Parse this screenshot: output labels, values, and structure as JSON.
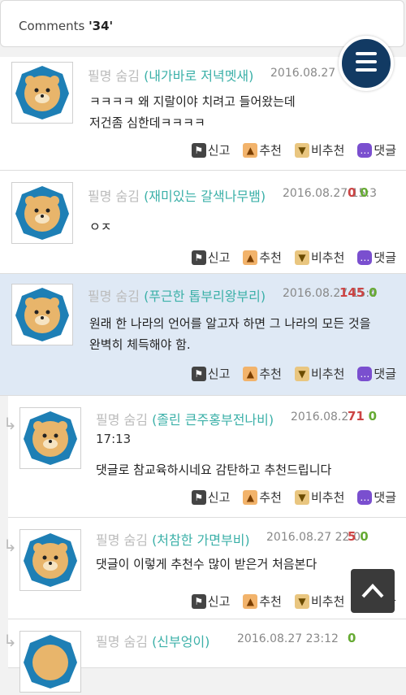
{
  "header": {
    "label": "Comments ",
    "count": "'34'"
  },
  "actions": {
    "report": "신고",
    "recommend": "추천",
    "unrecommend": "비추천",
    "reply": "댓글"
  },
  "comments": [
    {
      "author": "필명 숨김",
      "nickname": "(내가바로 저녁멧새)",
      "date": "2016.08.27",
      "up": "",
      "down": "",
      "lines": [
        "ㅋㅋㅋㅋ 왜 지랄이야 치려고 들어왔는데",
        "저건좀 심한데ㅋㅋㅋㅋ"
      ]
    },
    {
      "author": "필명 숨김",
      "nickname": "(재미있는 갈색나무뱀)",
      "date": "2016.08.27 15:3",
      "up": "0",
      "down": "0",
      "lines": [
        "ㅇㅈ"
      ]
    },
    {
      "author": "필명 숨김",
      "nickname": "(푸근한 톱부리왕부리)",
      "date": "2016.08.27 15:4",
      "up": "145",
      "down": "0",
      "lines": [
        "원래 한 나라의 언어를 알고자 하면 그 나라의 모든 것을",
        "완벽히 체득해야 함."
      ]
    },
    {
      "author": "필명 숨김",
      "nickname": "(졸린 큰주홍부전나비)",
      "date": "2016.08.2",
      "up": "71",
      "down": "0",
      "time": "17:13",
      "lines": [
        "댓글로 참교육하시네요 감탄하고 추천드립니다"
      ]
    },
    {
      "author": "필명 숨김",
      "nickname": "(처참한 가면부비)",
      "date": "2016.08.27 22:0",
      "up": "5",
      "down": "0",
      "lines": [
        "댓글이 이렇게 추천수 많이 받은거 처음본다"
      ]
    },
    {
      "author": "필명 숨김",
      "nickname": "(신부엉이)",
      "date": "2016.08.27 23:12",
      "up": "",
      "down": "0",
      "lines": []
    }
  ],
  "colors": {
    "menu_button": "#123a63",
    "nickname": "#3bb0a8",
    "highlight_row": "#dfe9f5"
  }
}
